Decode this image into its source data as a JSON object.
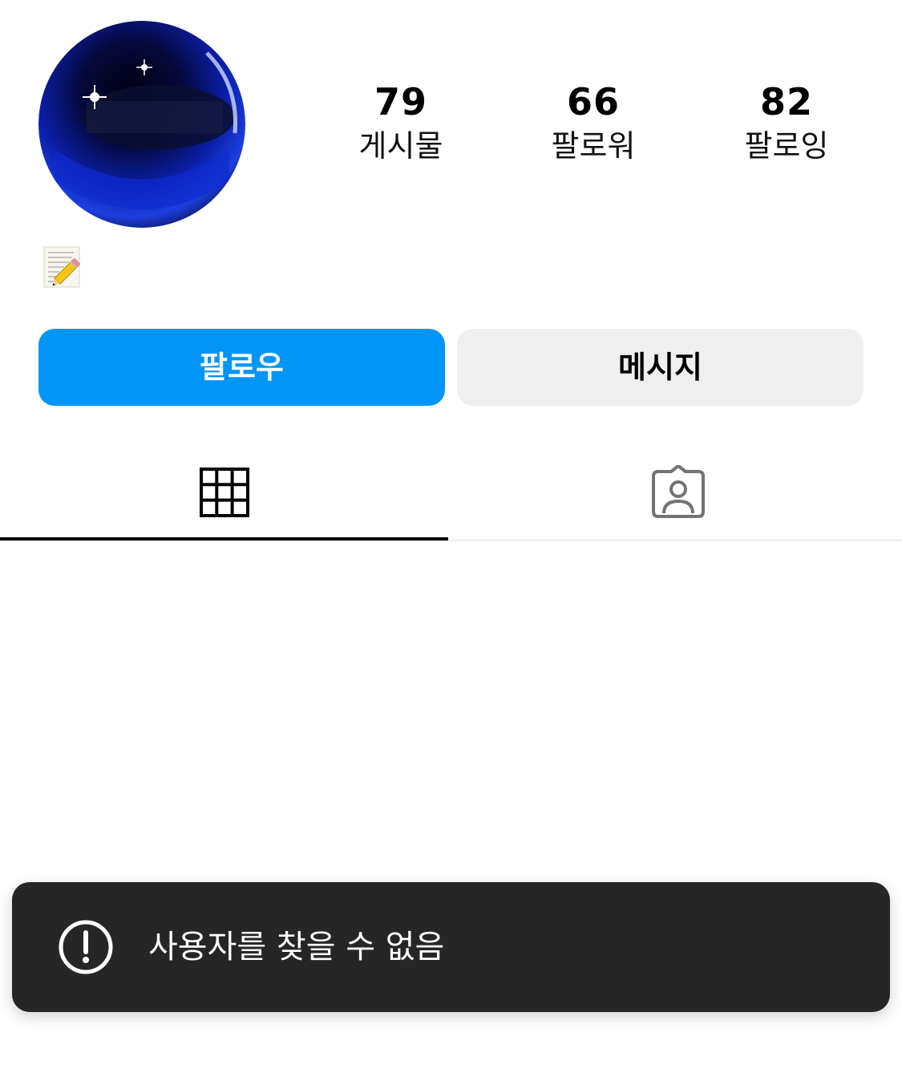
{
  "profile": {
    "avatar_icon": "blue-chrome-sphere-avatar",
    "bio_emoji": "📝",
    "bio_emoji_icon": "memo-icon"
  },
  "stats": {
    "posts": {
      "value": "79",
      "label": "게시물"
    },
    "followers": {
      "value": "66",
      "label": "팔로워"
    },
    "following": {
      "value": "82",
      "label": "팔로잉"
    }
  },
  "actions": {
    "follow_label": "팔로우",
    "message_label": "메시지"
  },
  "tabs": [
    {
      "name": "grid",
      "icon": "grid-icon",
      "active": true
    },
    {
      "name": "tagged",
      "icon": "tagged-person-icon",
      "active": false
    }
  ],
  "toast": {
    "icon": "alert-circle-icon",
    "message": "사용자를 찾을 수 없음"
  },
  "colors": {
    "follow_button": "#0095f6",
    "message_button": "#efefef",
    "toast_background": "#262626"
  }
}
